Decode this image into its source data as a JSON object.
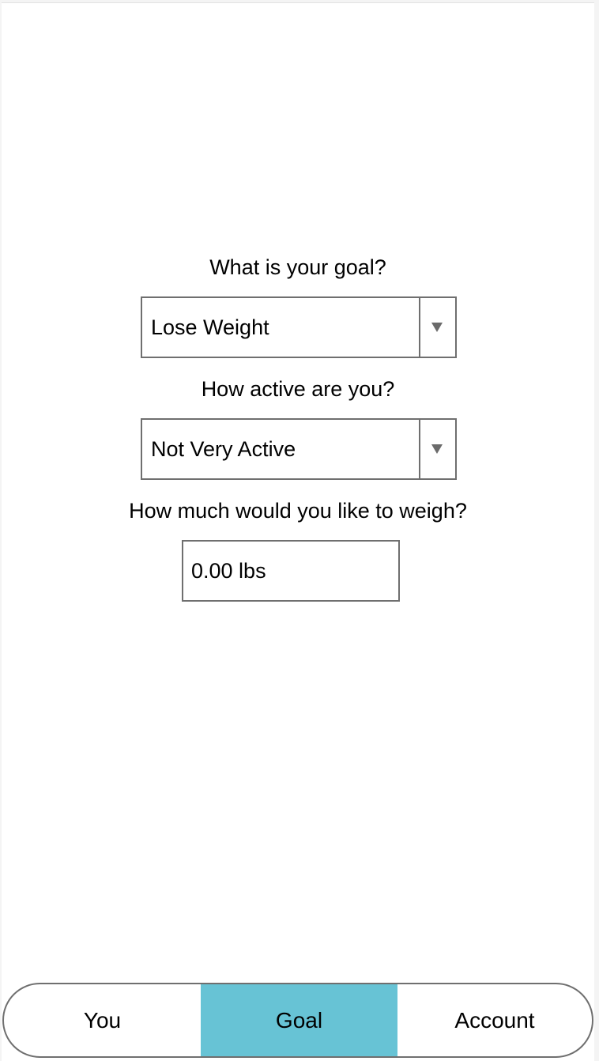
{
  "form": {
    "goal": {
      "question": "What is your goal?",
      "selected": "Lose Weight"
    },
    "activity": {
      "question": "How active are you?",
      "selected": "Not Very Active"
    },
    "target_weight": {
      "question": "How much would you like to weigh?",
      "value": "0.00 lbs"
    }
  },
  "tabs": {
    "you": "You",
    "goal": "Goal",
    "account": "Account",
    "active_tab": "Goal",
    "active_color": "#67c3d5"
  },
  "icons": {
    "dropdown": "triangle-down-icon"
  }
}
